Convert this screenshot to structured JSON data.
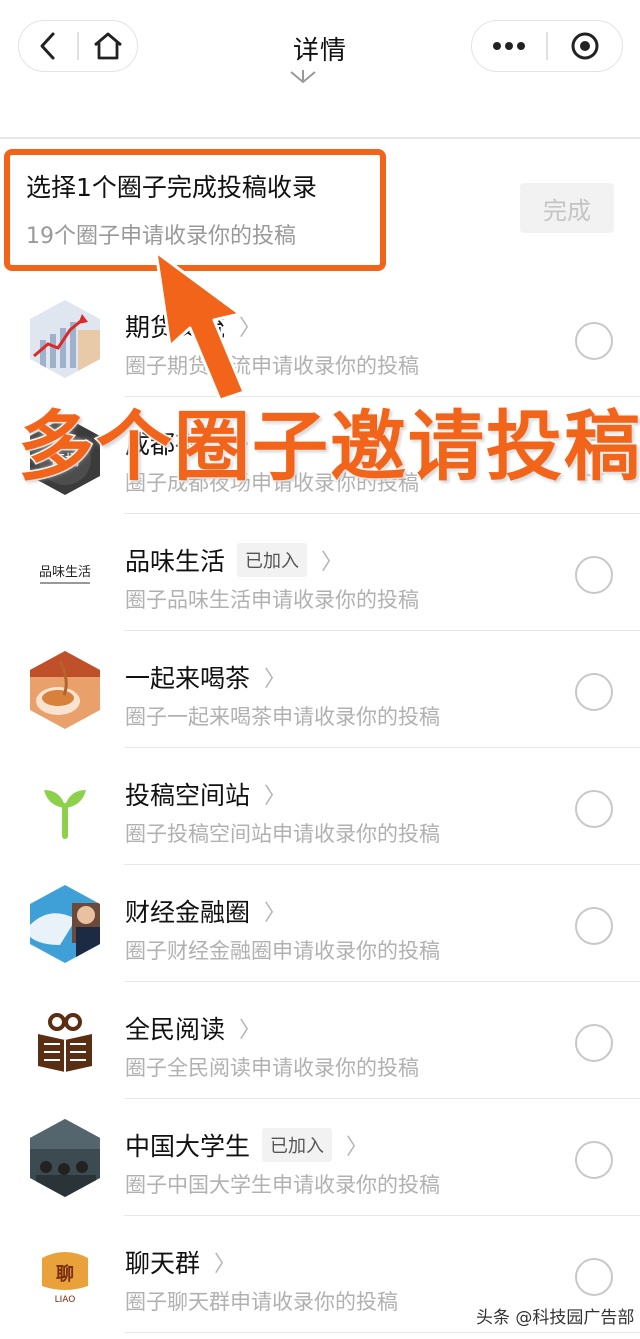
{
  "nav": {
    "title": "详情",
    "back_icon": "chevron-left-icon",
    "home_icon": "home-icon",
    "more_icon": "more-dots-icon",
    "close_icon": "target-close-icon"
  },
  "header": {
    "title": "选择1个圈子完成投稿收录",
    "subtitle": "19个圈子申请收录你的投稿",
    "done_label": "完成"
  },
  "annotation": {
    "banner_text": "多个圈子邀请投稿",
    "accent_color": "#f26419"
  },
  "circles": [
    {
      "name": "期货交流",
      "joined": "",
      "desc": "圈子期货交流申请收录你的投稿",
      "avatar": "chart-avatar"
    },
    {
      "name": "成都夜场",
      "joined": "",
      "desc": "圈子成都夜场申请收录你的投稿",
      "avatar": "night-avatar"
    },
    {
      "name": "品味生活",
      "joined": "已加入",
      "desc": "圈子品味生活申请收录你的投稿",
      "avatar": "pinwei-logo"
    },
    {
      "name": "一起来喝茶",
      "joined": "",
      "desc": "圈子一起来喝茶申请收录你的投稿",
      "avatar": "tea-avatar"
    },
    {
      "name": "投稿空间站",
      "joined": "",
      "desc": "圈子投稿空间站申请收录你的投稿",
      "avatar": "sprout-avatar"
    },
    {
      "name": "财经金融圈",
      "joined": "",
      "desc": "圈子财经金融圈申请收录你的投稿",
      "avatar": "shark-avatar"
    },
    {
      "name": "全民阅读",
      "joined": "",
      "desc": "圈子全民阅读申请收录你的投稿",
      "avatar": "book-owl-avatar"
    },
    {
      "name": "中国大学生",
      "joined": "已加入",
      "desc": "圈子中国大学生申请收录你的投稿",
      "avatar": "classroom-avatar"
    },
    {
      "name": "聊天群",
      "joined": "",
      "desc": "圈子聊天群申请收录你的投稿",
      "avatar": "liao-logo"
    }
  ],
  "watermark": "头条 @科技园广告部"
}
